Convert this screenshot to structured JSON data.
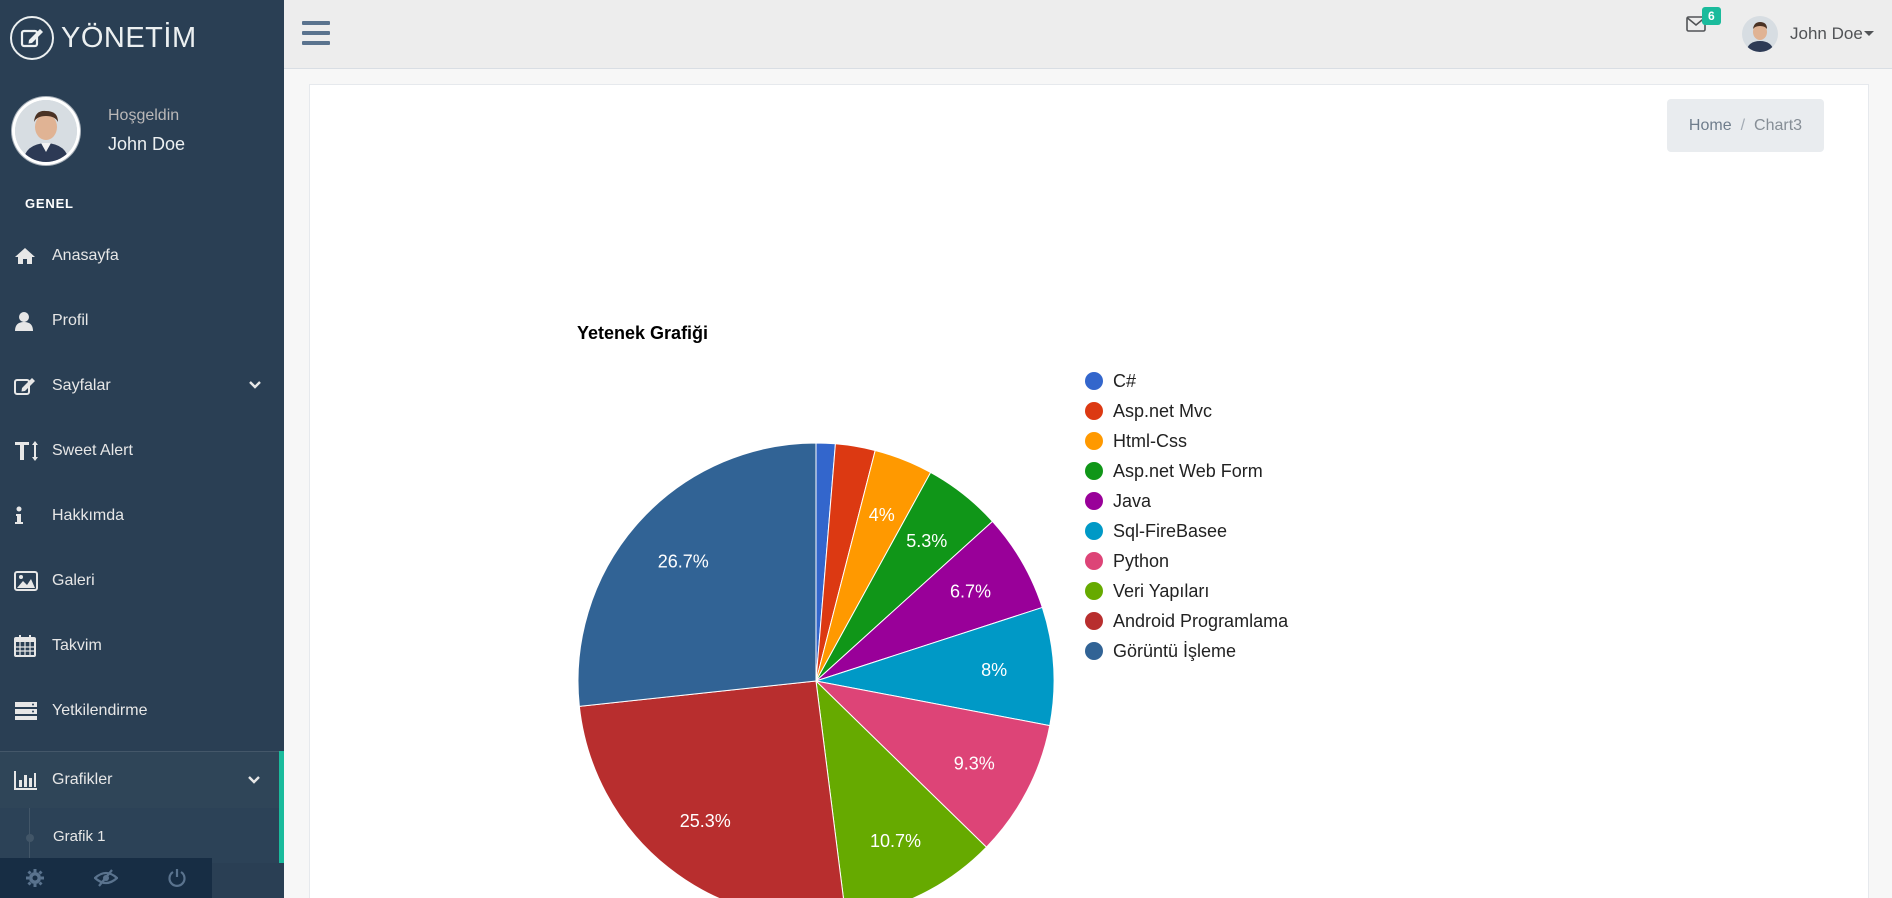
{
  "sidebar": {
    "brand": "YÖNETİM",
    "welcome": "Hoşgeldin",
    "user_name": "John Doe",
    "section": "GENEL",
    "items": [
      {
        "label": "Anasayfa",
        "icon": "home-icon"
      },
      {
        "label": "Profil",
        "icon": "user-icon"
      },
      {
        "label": "Sayfalar",
        "icon": "edit-icon"
      },
      {
        "label": "Sweet Alert",
        "icon": "text-height-icon"
      },
      {
        "label": "Hakkımda",
        "icon": "info-icon"
      },
      {
        "label": "Galeri",
        "icon": "image-icon"
      },
      {
        "label": "Takvim",
        "icon": "calendar-icon"
      },
      {
        "label": "Yetkilendirme",
        "icon": "server-icon"
      },
      {
        "label": "Grafikler",
        "icon": "bar-chart-icon"
      }
    ],
    "submenu": {
      "label": "Grafik 1"
    },
    "footer": [
      "settings-icon",
      "eye-slash-icon",
      "power-icon"
    ]
  },
  "topnav": {
    "mail_count": "6",
    "user_name": "John Doe"
  },
  "breadcrumb": {
    "home": "Home",
    "separator": "/",
    "current": "Chart3"
  },
  "chart_data": {
    "type": "pie",
    "title": "Yetenek Grafiği",
    "legend_position": "right",
    "categories": [
      "C#",
      "Asp.net Mvc",
      "Html-Css",
      "Asp.net Web Form",
      "Java",
      "Sql-FireBasee",
      "Python",
      "Veri Yapıları",
      "Android Programlama",
      "Görüntü İşleme"
    ],
    "values": [
      1.3,
      2.7,
      4,
      5.3,
      6.7,
      8,
      9.3,
      10.7,
      25.3,
      26.7
    ],
    "labels": [
      "",
      "",
      "4%",
      "5.3%",
      "6.7%",
      "8%",
      "9.3%",
      "10.7%",
      "25.3%",
      "26.7%"
    ],
    "colors": [
      "#3366cc",
      "#dc3912",
      "#ff9900",
      "#109618",
      "#990099",
      "#0099c6",
      "#dd4477",
      "#66aa00",
      "#b82e2e",
      "#316395"
    ]
  }
}
